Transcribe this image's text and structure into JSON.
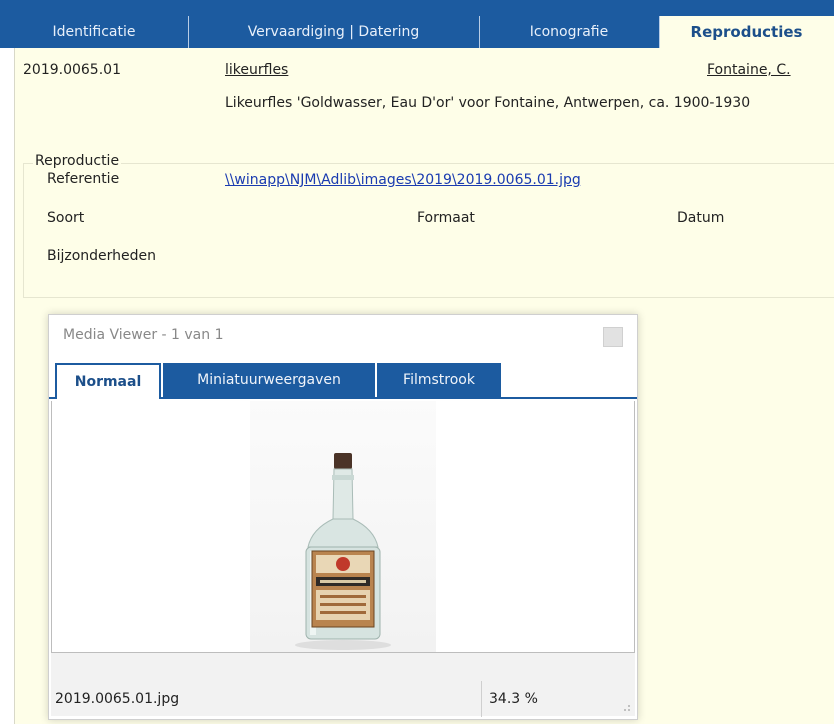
{
  "tabs": [
    "Identificatie",
    "Vervaardiging | Datering",
    "Iconografie",
    "Reproducties"
  ],
  "record": {
    "object_number": "2019.0065.01",
    "object_name": "likeurfles",
    "maker": "Fontaine, C.",
    "title": "Likeurfles 'Goldwasser, Eau D'or' voor Fontaine, Antwerpen, ca. 1900-1930"
  },
  "reproduction": {
    "group_label": "Reproductie",
    "reference_label": "Referentie",
    "reference_value": "\\\\winapp\\NJM\\Adlib\\images\\2019\\2019.0065.01.jpg",
    "type_label": "Soort",
    "format_label": "Formaat",
    "date_label": "Datum",
    "notes_label": "Bijzonderheden"
  },
  "media_viewer": {
    "title": "Media Viewer - 1 van 1",
    "tabs": [
      "Normaal",
      "Miniatuurweergaven",
      "Filmstrook"
    ],
    "filename": "2019.0065.01.jpg",
    "zoom": "34.3 %"
  },
  "colors": {
    "tab_bar": "#1c5ba0",
    "panel_background": "#fefee8",
    "link": "#1a3bb0"
  }
}
